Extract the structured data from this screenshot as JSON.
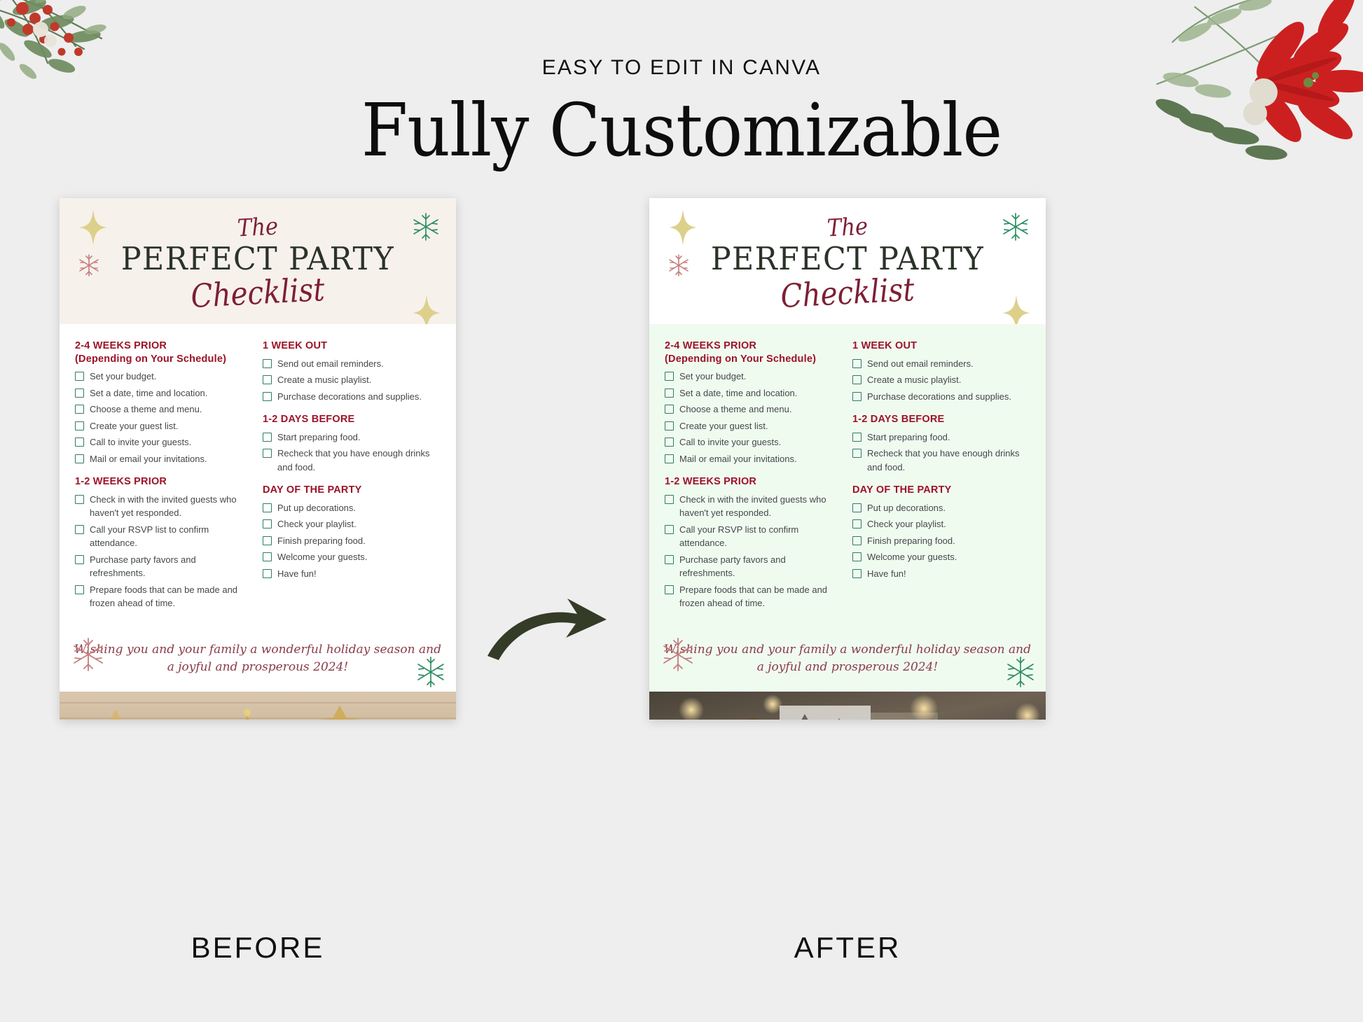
{
  "header": {
    "eyebrow": "EASY TO EDIT IN CANVA",
    "title": "Fully Customizable"
  },
  "colors": {
    "page_background": "#eeeeee",
    "before_header_bg": "#f7f1ec",
    "after_body_bg": "#f0fbf0",
    "heading_red": "#9c1328",
    "script_red": "#7d1f35",
    "title_green": "#2b3328",
    "checkbox_green": "#2e7d64",
    "arrow_olive": "#343b26",
    "wish_text": "#8a3b47",
    "gold_star": "#ddd08a",
    "snowflake_red": "#c57f7f",
    "snowflake_green": "#2f8f63"
  },
  "checklist": {
    "script_top": "The",
    "title": "PERFECT PARTY",
    "script_bottom": "Checklist",
    "wish_line_1": "Wishing you and your family a wonderful holiday season and",
    "wish_line_2": "a joyful and prosperous 2024!",
    "left_column": [
      {
        "heading": "2-4 WEEKS PRIOR",
        "subheading": "(Depending on Your Schedule)",
        "items": [
          "Set your budget.",
          "Set a date, time and location.",
          "Choose a theme and menu.",
          "Create your guest list.",
          "Call to invite your guests.",
          "Mail or email your invitations."
        ]
      },
      {
        "heading": "1-2 WEEKS PRIOR",
        "subheading": "",
        "items": [
          "Check in with the invited guests who haven't yet responded.",
          "Call your RSVP list to confirm attendance.",
          "Purchase party favors and refreshments.",
          "Prepare foods that can be made and frozen ahead of time."
        ]
      }
    ],
    "right_column": [
      {
        "heading": "1 WEEK OUT",
        "subheading": "",
        "items": [
          "Send out email reminders.",
          "Create a music playlist.",
          "Purchase decorations and supplies."
        ]
      },
      {
        "heading": "1-2 DAYS BEFORE",
        "subheading": "",
        "items": [
          "Start preparing food.",
          "Recheck that you have enough drinks and food."
        ]
      },
      {
        "heading": "DAY OF THE PARTY",
        "subheading": "",
        "items": [
          "Put up decorations.",
          "Check your playlist.",
          "Finish preparing food.",
          "Welcome your guests.",
          "Have fun!"
        ]
      }
    ]
  },
  "captions": {
    "before": "BEFORE",
    "after": "AFTER"
  },
  "icons": {
    "sparkle": "sparkle-star-icon",
    "snowflake": "snowflake-icon",
    "arrow": "curved-arrow-icon",
    "floral": "poinsettia-floral-icon"
  }
}
